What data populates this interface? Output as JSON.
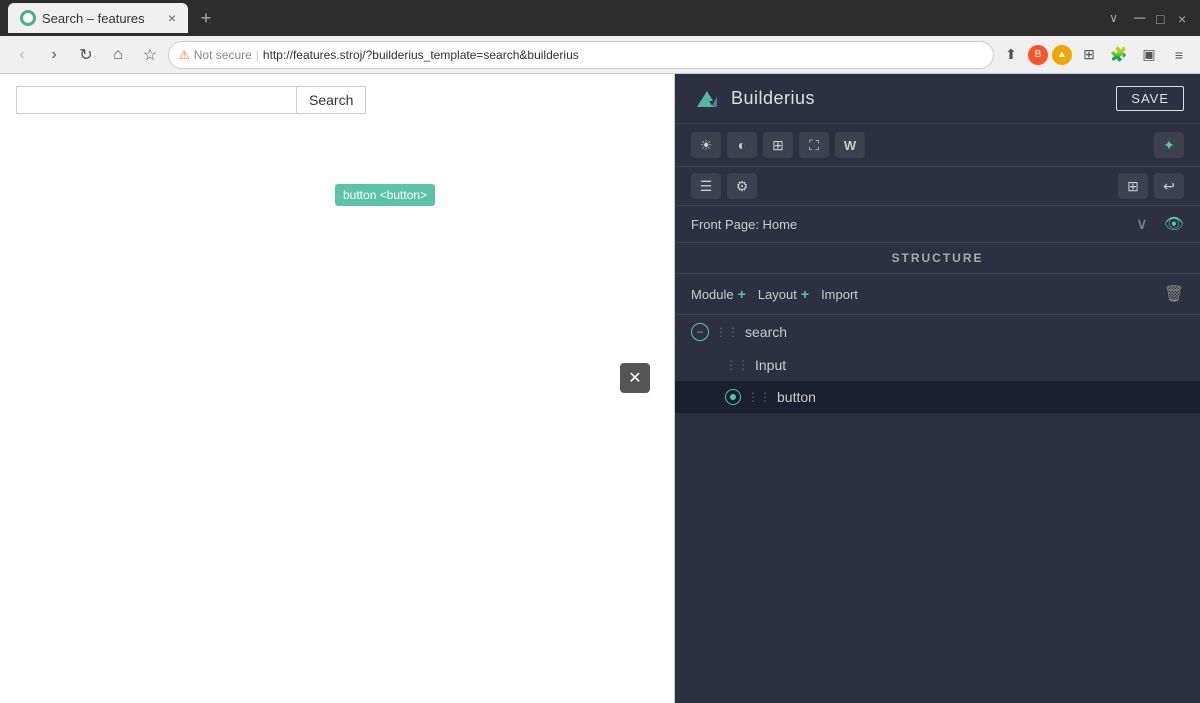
{
  "browser": {
    "tab_title": "Search – features",
    "tab_close": "×",
    "tab_new": "+",
    "tabs_overflow": "∨",
    "nav": {
      "back": "‹",
      "forward": "›",
      "refresh": "↺",
      "home": "⌂",
      "bookmark": "☆",
      "warning": "⚠",
      "warning_text": "Not secure",
      "url": "http://features.stroj/?builderius_template=search&builderius",
      "share": "⬆",
      "extensions": "⬛",
      "menu": "≡"
    }
  },
  "preview": {
    "search_button_label": "Search",
    "button_tooltip": "button <button>"
  },
  "builder": {
    "logo_text": "Builderius",
    "save_label": "SAVE",
    "toolbar": {
      "btn1": "☀",
      "btn2": "◐",
      "btn3": "⊞",
      "btn4": "⛶",
      "btn5": "W",
      "btn_right": "✦",
      "btn6": "☰",
      "btn7": "⚙",
      "btn8": "⊞",
      "btn9": "↩"
    },
    "page_selector": {
      "label": "Front Page: Home",
      "chevron": "∨"
    },
    "structure_header": "STRUCTURE",
    "actions": {
      "module": "Module",
      "module_plus": "+",
      "layout": "Layout",
      "layout_plus": "+",
      "import": "Import",
      "delete": "🗑"
    },
    "tree": {
      "items": [
        {
          "id": "search",
          "label": "search",
          "level": 1,
          "has_expand": true,
          "expanded": true
        },
        {
          "id": "input",
          "label": "Input",
          "level": 2,
          "has_expand": false
        },
        {
          "id": "button",
          "label": "button",
          "level": 2,
          "has_expand": false,
          "has_status": true,
          "selected": true
        }
      ]
    }
  }
}
